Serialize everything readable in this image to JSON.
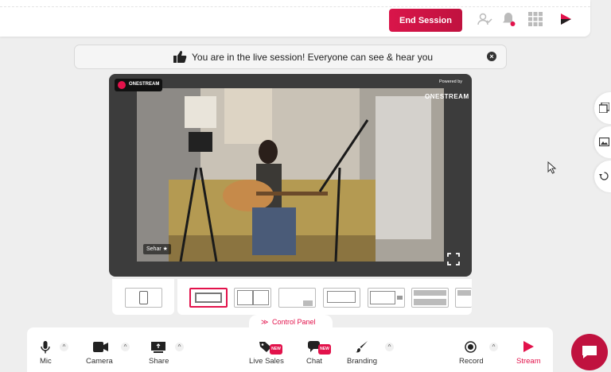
{
  "topbar": {
    "end_session_label": "End Session"
  },
  "banner": {
    "message": "You are in the live session! Everyone can see & hear you"
  },
  "stage": {
    "brand": "ONESTREAM",
    "powered_by": "Powered by",
    "watermark": "ONESTREAM",
    "participant_name": "Sehar"
  },
  "control_panel": {
    "label": "Control Panel",
    "items": [
      {
        "label": "Mic",
        "icon": "mic-icon"
      },
      {
        "label": "Camera",
        "icon": "camera-icon"
      },
      {
        "label": "Share",
        "icon": "screen-share-icon"
      },
      {
        "label": "Live Sales",
        "icon": "tag-icon",
        "badge": "NEW"
      },
      {
        "label": "Chat",
        "icon": "chat-icon",
        "badge": "NEW"
      },
      {
        "label": "Branding",
        "icon": "brush-icon"
      },
      {
        "label": "Record",
        "icon": "record-icon"
      },
      {
        "label": "Stream",
        "icon": "stream-icon"
      }
    ]
  },
  "colors": {
    "accent": "#e2124b",
    "end_session": "#d9154a"
  }
}
